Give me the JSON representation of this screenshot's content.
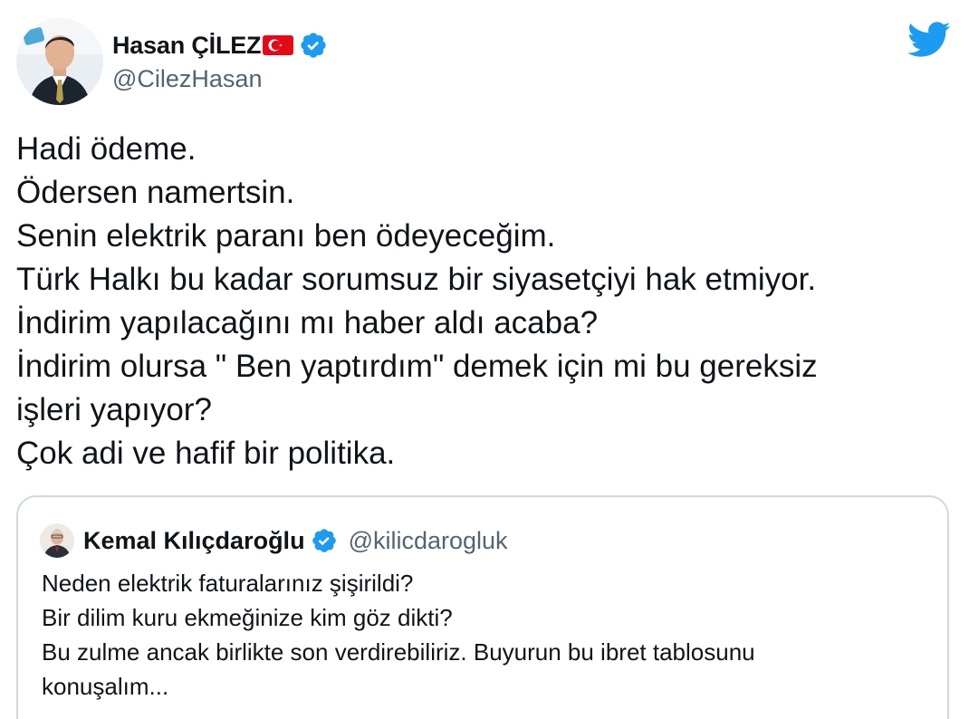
{
  "author": {
    "display_name": "Hasan ÇİLEZ",
    "handle": "@CilezHasan",
    "flag": "turkey-flag-emoji",
    "verified": true
  },
  "brand": {
    "logo": "twitter-bird-icon",
    "color": "#1d9bf0"
  },
  "tweet": {
    "lines": [
      "Hadi ödeme.",
      "Ödersen namertsin.",
      "Senin elektrik paranı ben ödeyeceğim.",
      "Türk Halkı bu kadar sorumsuz bir siyasetçiyi hak etmiyor.",
      "İndirim yapılacağını mı haber aldı acaba?",
      "İndirim olursa \" Ben yaptırdım\" demek için mi bu gereksiz",
      "işleri yapıyor?",
      "Çok adi ve hafif bir politika."
    ]
  },
  "quoted_tweet": {
    "display_name": "Kemal Kılıçdaroğlu",
    "handle": "@kilicdarogluk",
    "verified": true,
    "lines": [
      "Neden elektrik faturalarınız şişirildi?",
      "Bir dilim kuru ekmeğinize kim göz dikti?",
      "Bu zulme ancak birlikte son verdirebiliriz. Buyurun bu ibret tablosunu",
      "konuşalım..."
    ]
  },
  "colors": {
    "text": "#0f1419",
    "secondary": "#536471",
    "border": "#cfd9de",
    "verified": "#1d9bf0",
    "flag_red": "#e30a17"
  }
}
